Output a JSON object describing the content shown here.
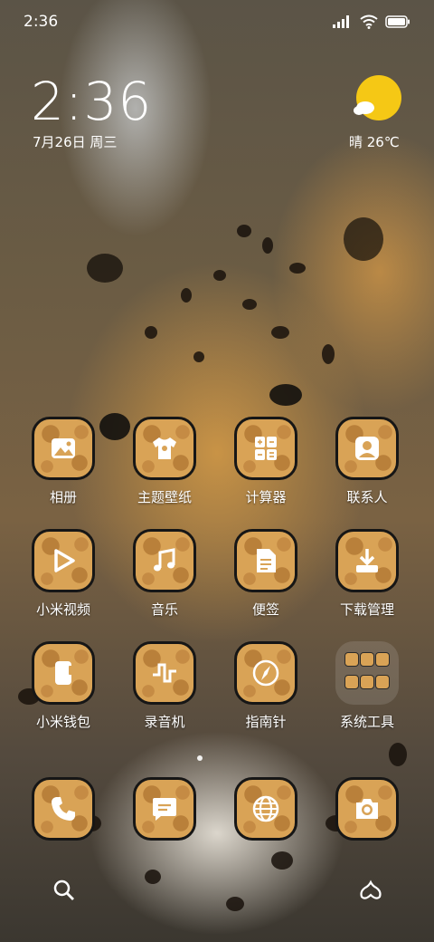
{
  "status": {
    "time": "2:36",
    "battery_icon": "battery-icon",
    "wifi_icon": "wifi-icon",
    "signal_icon": "signal-icon"
  },
  "clock": {
    "time": "2:36",
    "date": "7月26日 周三"
  },
  "weather": {
    "icon": "sun-cloud-icon",
    "text": "晴 26℃"
  },
  "apps": [
    {
      "label": "相册",
      "icon": "gallery-icon"
    },
    {
      "label": "主题壁纸",
      "icon": "theme-shirt-icon"
    },
    {
      "label": "计算器",
      "icon": "calculator-icon"
    },
    {
      "label": "联系人",
      "icon": "contacts-icon"
    },
    {
      "label": "小米视频",
      "icon": "video-play-icon"
    },
    {
      "label": "音乐",
      "icon": "music-note-icon"
    },
    {
      "label": "便签",
      "icon": "notes-icon"
    },
    {
      "label": "下载管理",
      "icon": "download-icon"
    },
    {
      "label": "小米钱包",
      "icon": "wallet-icon"
    },
    {
      "label": "录音机",
      "icon": "recorder-wave-icon"
    },
    {
      "label": "指南针",
      "icon": "compass-icon"
    },
    {
      "label": "系统工具",
      "icon": "folder-icon"
    }
  ],
  "dock": [
    {
      "icon": "phone-icon"
    },
    {
      "icon": "messages-icon"
    },
    {
      "icon": "browser-globe-icon"
    },
    {
      "icon": "camera-icon"
    }
  ],
  "bottom": {
    "left_icon": "search-icon",
    "right_icon": "assistant-icon"
  },
  "colors": {
    "tile_fill": "#d9a356",
    "tile_spot": "#b9803a",
    "tile_border": "#161616",
    "sun": "#f5c815"
  }
}
